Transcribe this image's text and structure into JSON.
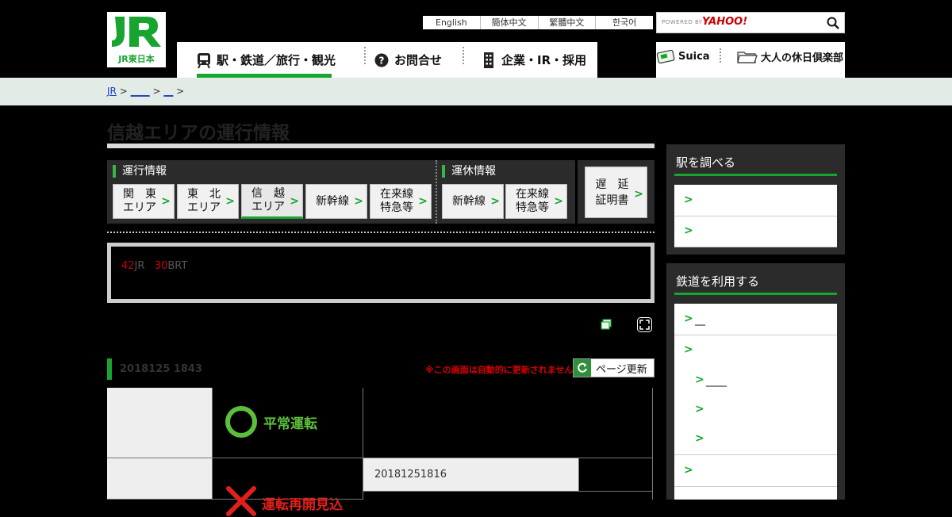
{
  "logo": {
    "text": "JR東日本"
  },
  "lang": [
    "English",
    "簡体中文",
    "繁體中文",
    "한국어"
  ],
  "search": {
    "powered": "POWERED BY",
    "provider": "YAHOO!"
  },
  "nav": [
    {
      "label": "駅・鉄道／旅行・観光",
      "icon": "train-icon"
    },
    {
      "label": "お問合せ",
      "icon": "help-icon"
    },
    {
      "label": "企業・IR・採用",
      "icon": "building-icon"
    }
  ],
  "subnav": [
    {
      "label": "Suica",
      "icon": "suica-card-icon"
    },
    {
      "label": "大人の休日倶楽部",
      "icon": "folder-icon"
    }
  ],
  "breadcrumb": {
    "items": [
      "JR",
      "____",
      "__"
    ],
    "sep": ">"
  },
  "page": {
    "title": "信越エリアの運行情報"
  },
  "tabs": {
    "group1_label": "運行情報",
    "group2_label": "運休情報",
    "group1": [
      "関　東\nエリア",
      "東　北\nエリア",
      "信　越\nエリア",
      "新幹線",
      "在来線\n特急等"
    ],
    "group2": [
      "新幹線",
      "在来線\n特急等"
    ],
    "delay_cert": "遅　延\n証明書"
  },
  "notice": {
    "num1": "42",
    "txt1": "JR",
    "num2": "30",
    "txt2": "BRT"
  },
  "update": {
    "time": "2018125 1843",
    "note": "※この画面は自動的に更新されません",
    "refresh": "ページ更新"
  },
  "status": {
    "normal": "平常運転",
    "suspended": "運転再開見込",
    "date": "20181251816"
  },
  "sidebar": {
    "box1_title": "駅を調べる",
    "box1_items": [
      "",
      ""
    ],
    "box2_title": "鉄道を利用する",
    "box2_items": [
      {
        "label": "__",
        "indent": false
      },
      {
        "label": "",
        "indent": false
      },
      {
        "label": "____",
        "indent": true
      },
      {
        "label": "",
        "indent": true
      },
      {
        "label": "",
        "indent": true
      },
      {
        "label": "",
        "indent": false
      }
    ]
  },
  "colors": {
    "brand_green": "#17a52f",
    "alert_red": "#e0201a"
  }
}
